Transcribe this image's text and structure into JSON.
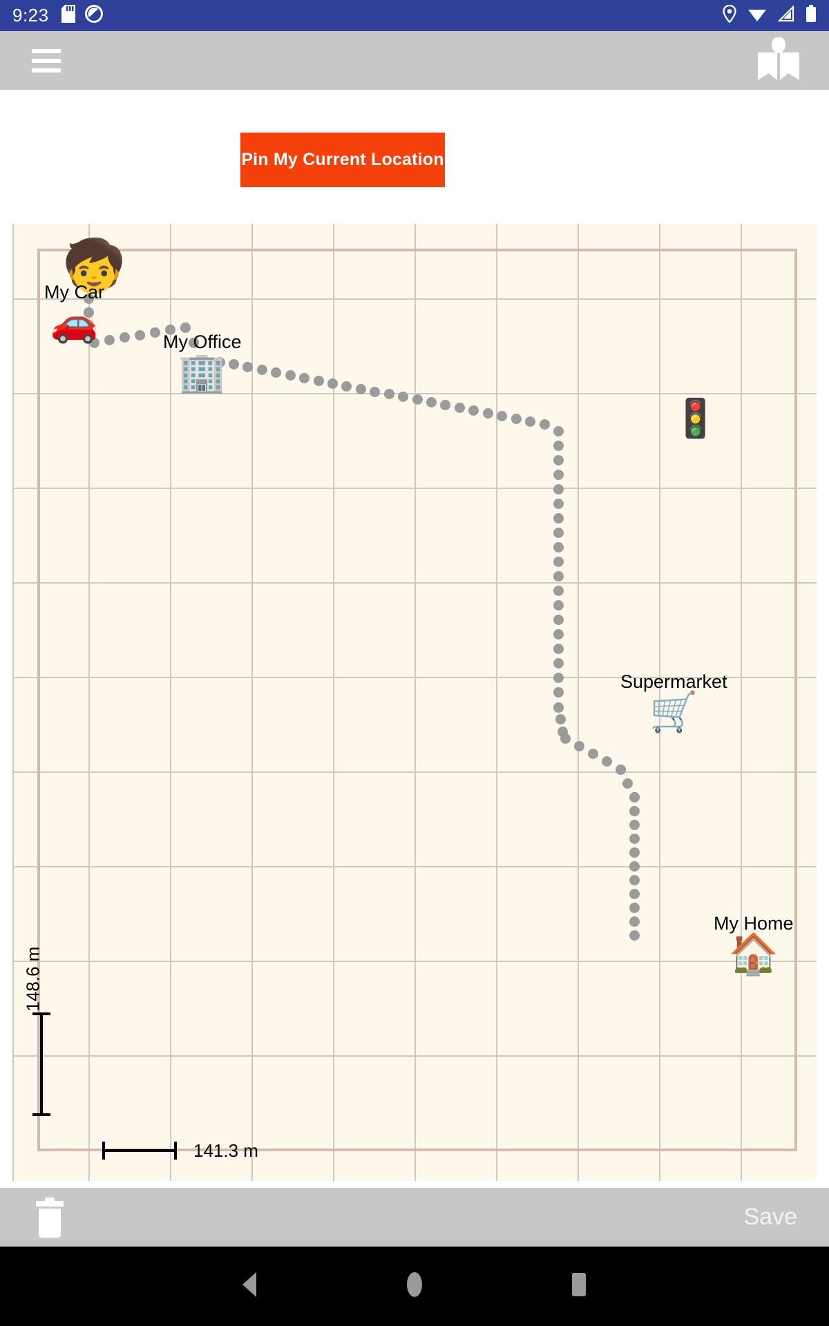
{
  "status_bar": {
    "clock": "9:23",
    "background_color": "#2E409A",
    "left_icons": [
      "sd-card-icon",
      "do-not-disturb-icon"
    ],
    "right_icons": [
      "location-pin-icon",
      "wifi-icon",
      "cell-signal-icon",
      "battery-icon"
    ]
  },
  "app_bar": {
    "background_color": "#C9C7C6",
    "menu_icon": "hamburger-menu-icon",
    "book_icon": "open-book-icon"
  },
  "action": {
    "pin_location_label": "Pin My Current Location",
    "button_color": "#F4410B"
  },
  "map": {
    "background_color": "#FDF8EB",
    "grid_color": "#CFCAC1",
    "boundary_color": "#D4B9AE",
    "path_dot_color": "#9B9B9B",
    "scale_vertical": "148.6 m",
    "scale_horizontal": "141.3 m",
    "points_of_interest": [
      {
        "name": "current-person",
        "label": "",
        "glyph": "🧒",
        "label_text": ""
      },
      {
        "name": "my-car",
        "label_text": "My Car",
        "glyph": "🚗"
      },
      {
        "name": "my-office",
        "label_text": "My Office",
        "glyph": "🏢"
      },
      {
        "name": "traffic-light",
        "label_text": "",
        "glyph": "🚦"
      },
      {
        "name": "supermarket",
        "label_text": "Supermarket",
        "glyph": "🛒"
      },
      {
        "name": "my-home",
        "label_text": "My Home",
        "glyph": "🏠"
      }
    ]
  },
  "bottom_bar": {
    "delete_icon": "trash-icon",
    "save_label": "Save",
    "background_color": "#C9C7C6"
  },
  "nav_bar": {
    "back_icon": "back-triangle-icon",
    "home_icon": "home-circle-icon",
    "recents_icon": "recents-square-icon"
  }
}
